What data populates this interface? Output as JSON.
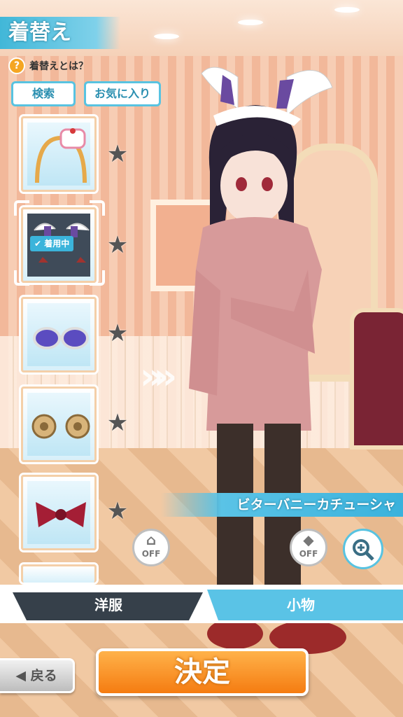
{
  "header": {
    "title": "着替え",
    "help_label": "着替えとは？",
    "help_icon": "question-icon"
  },
  "filters": {
    "search_label": "検索",
    "favorites_label": "お気に入り"
  },
  "items": [
    {
      "name": "cake-headband",
      "favorite": false
    },
    {
      "name": "bitter-bunny-katyusha",
      "favorite": false,
      "equipped": true,
      "equipped_label": "着用中"
    },
    {
      "name": "sunglasses",
      "favorite": false
    },
    {
      "name": "ram-horns",
      "favorite": false
    },
    {
      "name": "bow-scrunchie",
      "favorite": false
    }
  ],
  "preview": {
    "item_name": "ビターバニーカチューシャ",
    "arrows": "»»"
  },
  "toggles": {
    "clothes_off_label": "OFF",
    "cat_off_label": "OFF"
  },
  "tabs": {
    "clothes_label": "洋服",
    "accessories_label": "小物",
    "active": "小物"
  },
  "footer": {
    "back_label": "◀ 戻る",
    "decide_label": "決定"
  },
  "colors": {
    "accent": "#3ab2dc",
    "decide": "#f57c11",
    "star": "#555555"
  }
}
